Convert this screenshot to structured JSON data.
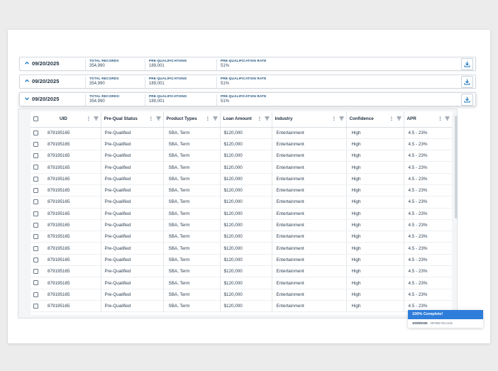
{
  "batches": [
    {
      "date": "09/20/2025",
      "chevron": "^",
      "total_label": "TOTAL RECORDS",
      "total_value": "354,990",
      "preq_label": "PRE-QUALIFICATIONS",
      "preq_value": "189,001",
      "rate_label": "PRE-QUALIFICATION RATE",
      "rate_value": "51%"
    },
    {
      "date": "09/20/2025",
      "chevron": "^",
      "total_label": "TOTAL RECORDS",
      "total_value": "354,990",
      "preq_label": "PRE-QUALIFICATIONS",
      "preq_value": "189,001",
      "rate_label": "PRE-QUALIFICATION RATE",
      "rate_value": "51%"
    },
    {
      "date": "09/20/2025",
      "chevron": "v",
      "total_label": "TOTAL RECORDS:",
      "total_value": "354,990",
      "preq_label": "PRE-QUALIFICATIONS",
      "preq_value": "189,001",
      "rate_label": "PRE-QUALIFICATION RATE",
      "rate_value": "51%"
    }
  ],
  "table": {
    "columns": [
      "UID",
      "Pre-Qual Status",
      "Product Types",
      "Loan Amount",
      "Industry",
      "Confidence",
      "APR"
    ],
    "rows": [
      [
        "879195165",
        "Pre-Qualified",
        "SBA, Term",
        "$120,000",
        "Entertainment",
        "High",
        "4.5 - 23%"
      ],
      [
        "879195165",
        "Pre-Qualified",
        "SBA, Term",
        "$120,000",
        "Entertainment",
        "High",
        "4.5 - 23%"
      ],
      [
        "879195165",
        "Pre-Qualified",
        "SBA, Term",
        "$120,000",
        "Entertainment",
        "High",
        "4.5 - 23%"
      ],
      [
        "879195165",
        "Pre-Qualified",
        "SBA, Term",
        "$120,000",
        "Entertainment",
        "High",
        "4.5 - 23%"
      ],
      [
        "879195165",
        "Pre-Qualified",
        "SBA, Term",
        "$120,000",
        "Entertainment",
        "High",
        "4.5 - 23%"
      ],
      [
        "879195165",
        "Pre-Qualified",
        "SBA, Term",
        "$120,000",
        "Entertainment",
        "High",
        "4.5 - 23%"
      ],
      [
        "879195165",
        "Pre-Qualified",
        "SBA, Term",
        "$120,000",
        "Entertainment",
        "High",
        "4.5 - 23%"
      ],
      [
        "879195165",
        "Pre-Qualified",
        "SBA, Term",
        "$120,000",
        "Entertainment",
        "High",
        "4.5 - 23%"
      ],
      [
        "879195165",
        "Pre-Qualified",
        "SBA, Term",
        "$120,000",
        "Entertainment",
        "High",
        "4.5 - 23%"
      ],
      [
        "879195165",
        "Pre-Qualified",
        "SBA, Term",
        "$120,000",
        "Entertainment",
        "High",
        "4.5 - 23%"
      ],
      [
        "879195165",
        "Pre-Qualified",
        "SBA, Term",
        "$120,000",
        "Entertainment",
        "High",
        "4.5 - 23%"
      ],
      [
        "879195165",
        "Pre-Qualified",
        "SBA, Term",
        "$120,000",
        "Entertainment",
        "High",
        "4.5 - 23%"
      ],
      [
        "879195165",
        "Pre-Qualified",
        "SBA, Term",
        "$120,000",
        "Entertainment",
        "High",
        "4.5 - 23%"
      ],
      [
        "879195165",
        "Pre-Qualified",
        "SBA, Term",
        "$120,000",
        "Entertainment",
        "High",
        "4.5 - 23%"
      ],
      [
        "879195165",
        "Pre-Qualified",
        "SBA, Term",
        "$120,000",
        "Entertainment",
        "High",
        "4.5 - 23%"
      ],
      [
        "879195165",
        "Pre-Qualified",
        "SBA, Term",
        "$120,000",
        "Entertainment",
        "High",
        "4.5 - 23%"
      ]
    ]
  },
  "toast": {
    "title": "100% Complete!",
    "date": "10/28/2025",
    "detail": "- 357868 Records"
  },
  "icons": {
    "expand": "chevron-up-icon",
    "collapse": "chevron-down-icon",
    "download": "download-icon",
    "column_menu": "kebab-menu-icon",
    "filter": "filter-icon"
  },
  "colors": {
    "accent": "#1b75bb",
    "toast_header": "#2f7ddb",
    "label_text": "#1b4f7a"
  }
}
